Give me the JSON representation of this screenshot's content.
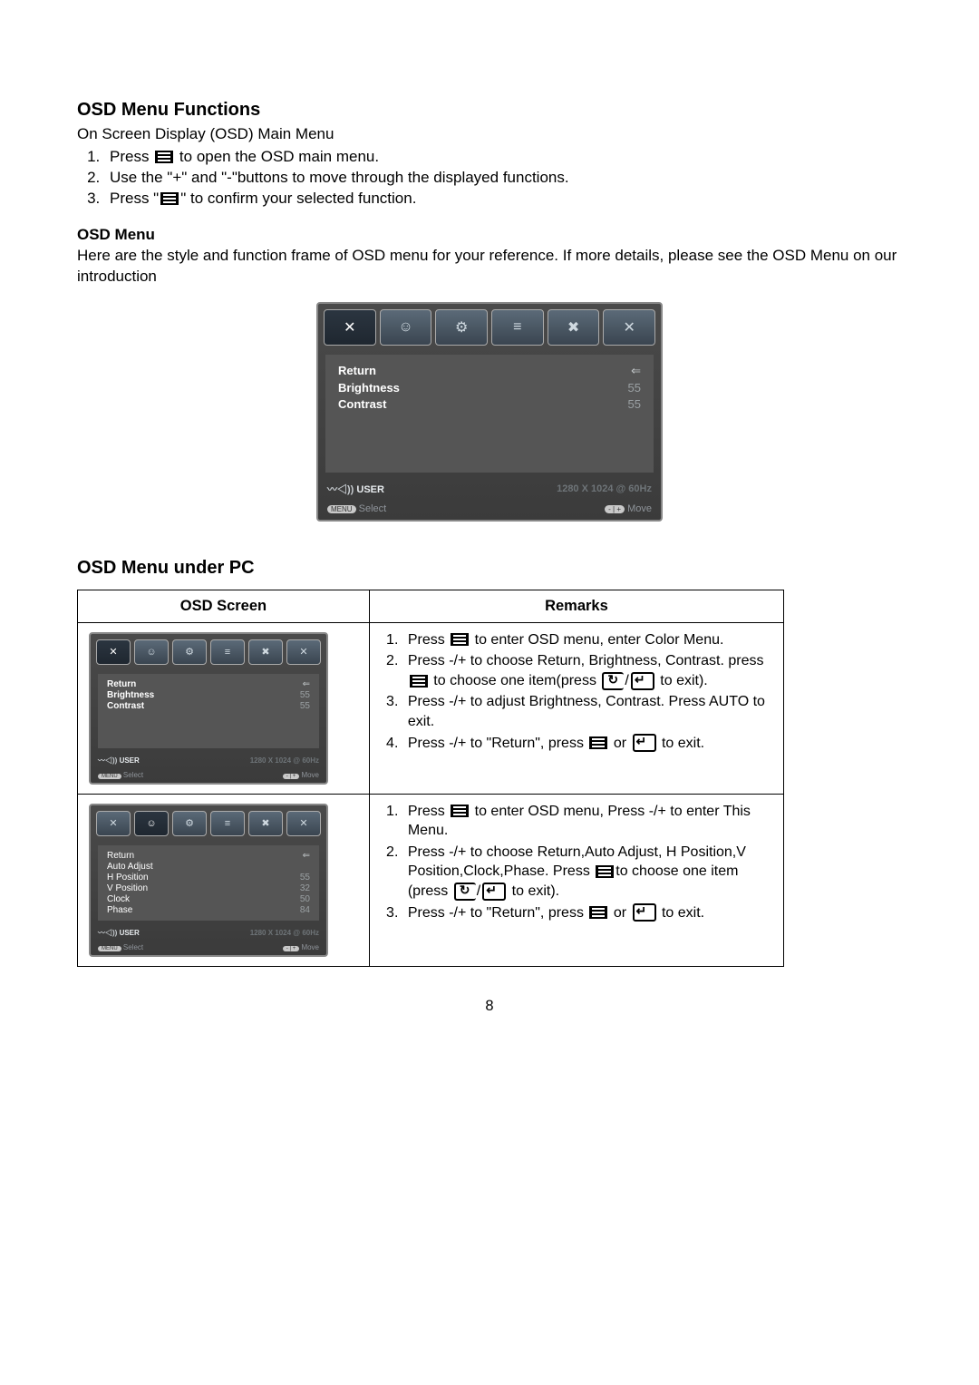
{
  "headings": {
    "h1": "OSD Menu Functions",
    "intro": "On Screen Display (OSD) Main Menu",
    "h2": "OSD Menu",
    "h2_intro": "Here are the style and function frame of OSD menu for your reference. If more details, please see the OSD Menu on our introduction",
    "h3": "OSD Menu under PC"
  },
  "steps_top": {
    "s1a": "Press ",
    "s1b": " to open the OSD main menu.",
    "s2": "Use the \"+\" and \"-\"buttons to move through the displayed functions.",
    "s3a": "Press \"",
    "s3b": "\" to confirm your selected function."
  },
  "osd_big": {
    "tabs": [
      "✕",
      "☺",
      "⚙",
      "≡",
      "✖",
      "✕"
    ],
    "rows": [
      {
        "label": "Return",
        "arrow": "⇐",
        "bold": true
      },
      {
        "label": "Brightness",
        "value": "55",
        "bold": true
      },
      {
        "label": "Contrast",
        "value": "55",
        "bold": true
      }
    ],
    "brand": "USER",
    "res": "1280 X 1024 @ 60Hz",
    "sel": "Select",
    "move": "Move"
  },
  "osd_small1": {
    "sel_tab": 0,
    "rows": [
      {
        "label": "Return",
        "arrow": "⇐",
        "bold": true
      },
      {
        "label": "Brightness",
        "value": "55",
        "bold": true
      },
      {
        "label": "Contrast",
        "value": "55",
        "bold": true
      }
    ]
  },
  "osd_small2": {
    "sel_tab": 1,
    "rows": [
      {
        "label": "Return",
        "arrow": "⇐"
      },
      {
        "label": "Auto Adjust"
      },
      {
        "label": "H Position",
        "value": "55"
      },
      {
        "label": "V Position",
        "value": "32"
      },
      {
        "label": "Clock",
        "value": "50"
      },
      {
        "label": "Phase",
        "value": "84"
      }
    ]
  },
  "table": {
    "th1": "OSD Screen",
    "th2": "Remarks",
    "row1": {
      "l1a": "Press ",
      "l1b": " to enter OSD menu, enter Color Menu.",
      "l2a": "Press -/+ to choose Return, Brightness, Contrast. press ",
      "l2b": " to choose one item(press ",
      "l2c": " to exit).",
      "l3": "Press -/+ to adjust Brightness, Contrast. Press AUTO to exit.",
      "l4a": "Press -/+ to \"Return\", press ",
      "l4b": " or ",
      "l4c": " to exit."
    },
    "row2": {
      "l1a": "Press ",
      "l1b": " to enter OSD menu, Press -/+ to enter This Menu.",
      "l2a": "Press -/+ to choose Return,Auto Adjust, H Position,V Position,Clock,Phase. Press ",
      "l2b": "to choose one item (press ",
      "l2c": " to exit).",
      "l3a": "Press -/+ to \"Return\", press ",
      "l3b": " or ",
      "l3c": " to exit."
    }
  },
  "page": "8"
}
